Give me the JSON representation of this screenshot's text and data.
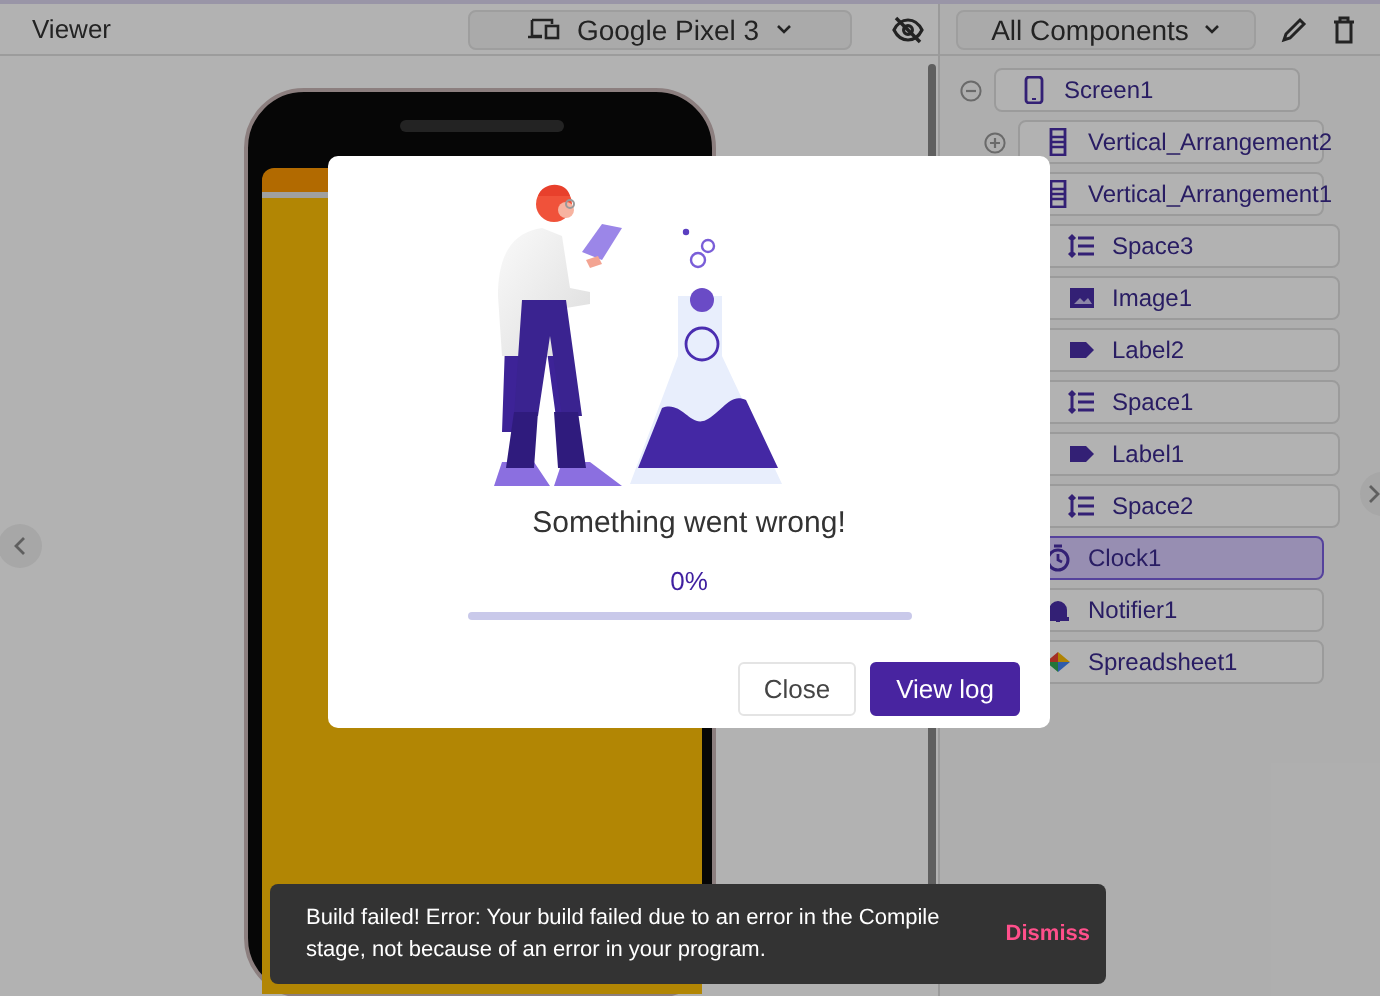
{
  "viewer": {
    "title": "Viewer",
    "device": "Google Pixel 3"
  },
  "components_panel": {
    "filter": "All Components",
    "tree": [
      {
        "name": "Screen1",
        "kind": "screen",
        "expanded": true,
        "selected": false,
        "children": [
          {
            "name": "Vertical_Arrangement2",
            "kind": "arrangement",
            "expanded": false,
            "selected": false
          },
          {
            "name": "Vertical_Arrangement1",
            "kind": "arrangement",
            "selected": false,
            "children": [
              {
                "name": "Space3",
                "kind": "space",
                "selected": false
              },
              {
                "name": "Image1",
                "kind": "image",
                "selected": false
              },
              {
                "name": "Label2",
                "kind": "label",
                "selected": false
              },
              {
                "name": "Space1",
                "kind": "space",
                "selected": false
              },
              {
                "name": "Label1",
                "kind": "label",
                "selected": false
              },
              {
                "name": "Space2",
                "kind": "space",
                "selected": false
              }
            ]
          },
          {
            "name": "Clock1",
            "kind": "clock",
            "selected": true
          },
          {
            "name": "Notifier1",
            "kind": "notifier",
            "selected": false
          },
          {
            "name": "Spreadsheet1",
            "kind": "spreadsheet",
            "selected": false
          }
        ]
      }
    ]
  },
  "dialog": {
    "title": "Something went wrong!",
    "progress_text": "0%",
    "progress": {
      "level": 0
    },
    "buttons": [
      {
        "label": "Close",
        "kind": "secondary"
      },
      {
        "label": "View log",
        "kind": "primary"
      }
    ]
  },
  "snackbar": {
    "message": "Build failed! Error: Your build failed due to an error in the Compile stage, not because of an error in your program.",
    "action": "Dismiss"
  }
}
